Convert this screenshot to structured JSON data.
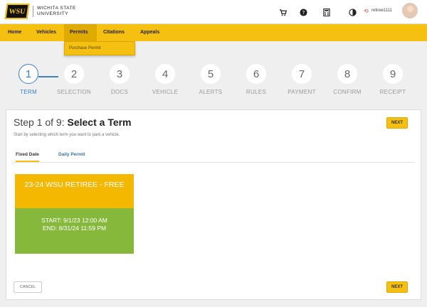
{
  "header": {
    "logo_mark": "WSU",
    "logo_line1": "WICHITA STATE",
    "logo_line2": "UNIVERSITY",
    "icons": [
      "cart-icon",
      "help-icon",
      "calculator-icon",
      "contrast-icon"
    ],
    "user_name": "retiree1111"
  },
  "nav": {
    "items": [
      "Home",
      "Vehicles",
      "Permits",
      "Citations",
      "Appeals"
    ],
    "active": "Permits",
    "dropdown": [
      "Purchase Permit"
    ]
  },
  "stepper": {
    "steps": [
      {
        "num": "1",
        "label": "TERM"
      },
      {
        "num": "2",
        "label": "SELECTION"
      },
      {
        "num": "3",
        "label": "DOCS"
      },
      {
        "num": "4",
        "label": "VEHICLE"
      },
      {
        "num": "5",
        "label": "ALERTS"
      },
      {
        "num": "6",
        "label": "RULES"
      },
      {
        "num": "7",
        "label": "PAYMENT"
      },
      {
        "num": "8",
        "label": "CONFIRM"
      },
      {
        "num": "9",
        "label": "RECEIPT"
      }
    ],
    "active_index": 0
  },
  "main": {
    "title_prefix": "Step 1 of 9:",
    "title_main": "Select a Term",
    "subtitle": "Start by selecting which term you want to park a vehicle.",
    "next_label": "NEXT",
    "cancel_label": "CANCEL",
    "tabs": [
      "Fixed Date",
      "Daily Permit"
    ],
    "term": {
      "name": "23-24 WSU RETIREE - FREE",
      "start": "START: 9/1/23 12:00 AM",
      "end": "END: 8/31/24 11:59 PM"
    }
  },
  "colors": {
    "brand_yellow": "#f5c010",
    "accent_blue": "#3b7fc4",
    "tile_green": "#86b83c"
  }
}
